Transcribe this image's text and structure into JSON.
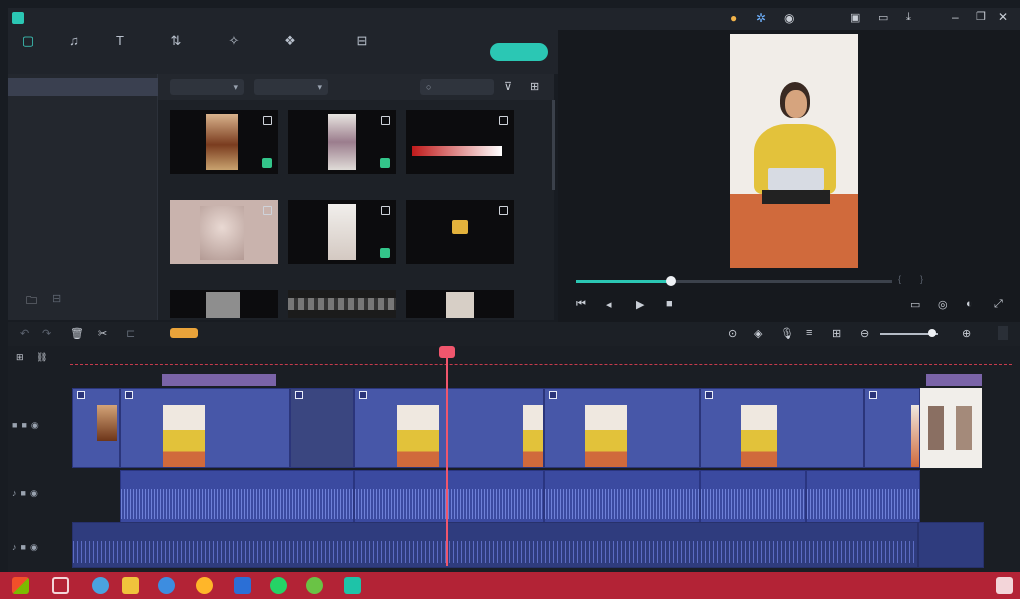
{
  "window": {
    "app_title": "",
    "project_title": "",
    "login": ""
  },
  "menu": [
    "",
    "",
    "",
    "",
    "",
    ""
  ],
  "toolbar": {
    "tools": [
      {
        "label": "",
        "icon": "folder-icon"
      },
      {
        "label": "",
        "icon": "music-icon"
      },
      {
        "label": "",
        "icon": "text-icon"
      },
      {
        "label": "",
        "icon": "transition-icon"
      },
      {
        "label": "",
        "icon": "effects-icon"
      },
      {
        "label": "",
        "icon": "elements-icon"
      },
      {
        "label": "",
        "icon": "split-screen-icon"
      }
    ],
    "export_label": ""
  },
  "sidebar": {
    "items": [
      {
        "label": "",
        "count": ""
      },
      {
        "label": "",
        "count": ""
      },
      {
        "label": "",
        "count": ""
      },
      {
        "label": "",
        "count": ""
      },
      {
        "label": "",
        "count": ""
      },
      {
        "label": "",
        "count": ""
      },
      {
        "label": "",
        "count": ""
      }
    ]
  },
  "media": {
    "import_label": "",
    "record_label": "",
    "search_placeholder": "",
    "thumbs": [
      {
        "name": ""
      },
      {
        "name": ""
      },
      {
        "name": ""
      },
      {
        "name": ""
      },
      {
        "name": ""
      },
      {
        "name": ""
      }
    ]
  },
  "player": {
    "timecode": "",
    "quality": "",
    "progress": 0.3
  },
  "timeline": {
    "ruler_marks": [
      "",
      "",
      "",
      "",
      "",
      "",
      "",
      "",
      ""
    ],
    "video_clips": [
      {
        "label": ""
      },
      {
        "label": ""
      },
      {
        "label": ""
      },
      {
        "label": ""
      },
      {
        "label": ""
      },
      {
        "label": ""
      },
      {
        "label": ""
      }
    ],
    "audio_clips": [
      {
        "label": ""
      },
      {
        "label": ""
      },
      {
        "label": ""
      },
      {
        "label": ""
      },
      {
        "label": ""
      }
    ],
    "music_clips": [
      {
        "label": ""
      },
      {
        "label": ""
      }
    ]
  },
  "taskbar": {
    "time": "",
    "date": ""
  },
  "colors": {
    "accent": "#2bc7b4",
    "clip": "#4757a8",
    "playhead": "#f0566d",
    "taskbar": "#b32336"
  }
}
